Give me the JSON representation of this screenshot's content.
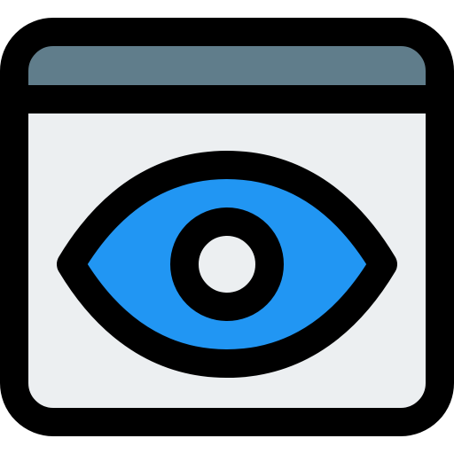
{
  "icon": {
    "name": "browser-window-eye-icon",
    "parts": [
      "window-frame-icon",
      "title-bar",
      "content-area",
      "eye-icon",
      "iris",
      "pupil"
    ]
  },
  "colors": {
    "outline": "#000000",
    "title_bar": "#607d8b",
    "content_area": "#eceff1",
    "eye": "#2196f3",
    "pupil": "#eceff1"
  }
}
